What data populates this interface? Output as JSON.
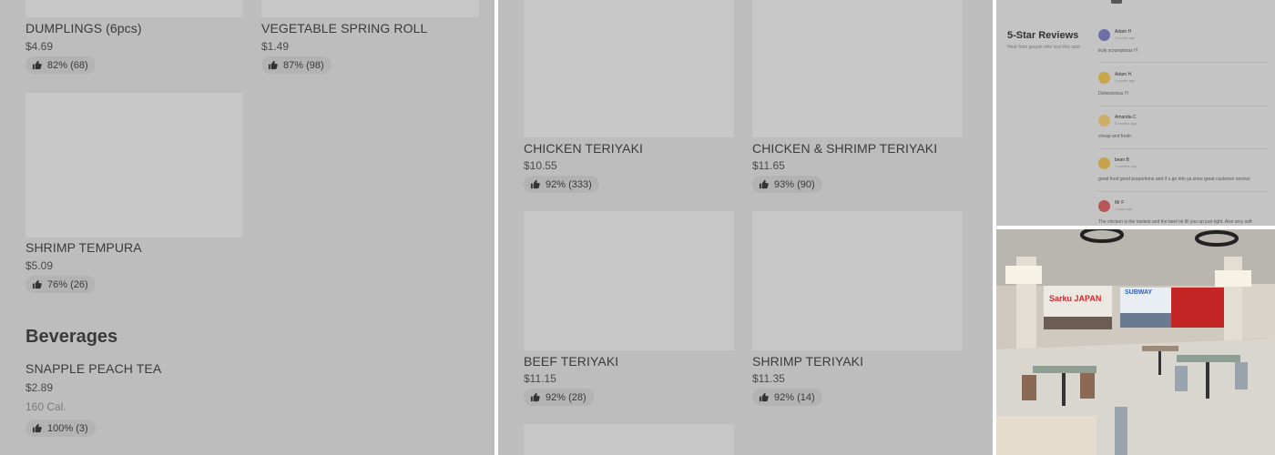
{
  "left_panel": {
    "items": [
      {
        "name": "DUMPLINGS (6pcs)",
        "price": "$4.69",
        "rating": "82% (68)"
      },
      {
        "name": "VEGETABLE SPRING ROLL",
        "price": "$1.49",
        "rating": "87% (98)"
      },
      {
        "name": "SHRIMP TEMPURA",
        "price": "$5.09",
        "rating": "76% (26)"
      }
    ],
    "beverages": {
      "title": "Beverages",
      "item": {
        "name": "SNAPPLE PEACH TEA",
        "price": "$2.89",
        "calories": "160 Cal.",
        "rating": "100% (3)"
      }
    }
  },
  "middle_panel": {
    "items": [
      {
        "name": "CHICKEN TERIYAKI",
        "price": "$10.55",
        "rating": "92% (333)"
      },
      {
        "name": "CHICKEN & SHRIMP TERIYAKI",
        "price": "$11.65",
        "rating": "93% (90)"
      },
      {
        "name": "BEEF TERIYAKI",
        "price": "$11.15",
        "rating": "92% (28)"
      },
      {
        "name": "SHRIMP TERIYAKI",
        "price": "$11.35",
        "rating": "92% (14)"
      }
    ]
  },
  "reviews_panel": {
    "title": "5-Star Reviews",
    "subtitle": "Hear from people who love this spot",
    "reviews": [
      {
        "name": "Adam H",
        "time": "1 month ago",
        "text": "truly scrumptious !!!",
        "avatar_color": "#6f6fa8"
      },
      {
        "name": "Adam H.",
        "time": "1 month ago",
        "text": "Delwwicious !!!",
        "avatar_color": "#c9a64a"
      },
      {
        "name": "Amanda C",
        "time": "5 months ago",
        "text": "cheap and fresh",
        "avatar_color": "#cfae6a"
      },
      {
        "name": "bean B",
        "time": "7 months ago",
        "text": "great food good porportions and if u go into ya store great customer service",
        "avatar_color": "#c6a24a"
      },
      {
        "name": "Mr F",
        "time": "1 year ago",
        "text": "The chicken is the tastiest and the beef ok fill you up just right. Also very soft",
        "avatar_color": "#b85555"
      }
    ]
  },
  "photo_panel": {
    "sign_left": "Sarku JAPAN",
    "sign_mid": "SUBWAY"
  },
  "colors": {
    "overlay": "#bdbdbd",
    "placeholder": "#c7c7c7",
    "pill": "#b3b3b3",
    "sign_red": "#d42a2a",
    "sign_blue": "#2e5fb3"
  },
  "icons": {
    "rating": "thumbs-up-icon"
  }
}
